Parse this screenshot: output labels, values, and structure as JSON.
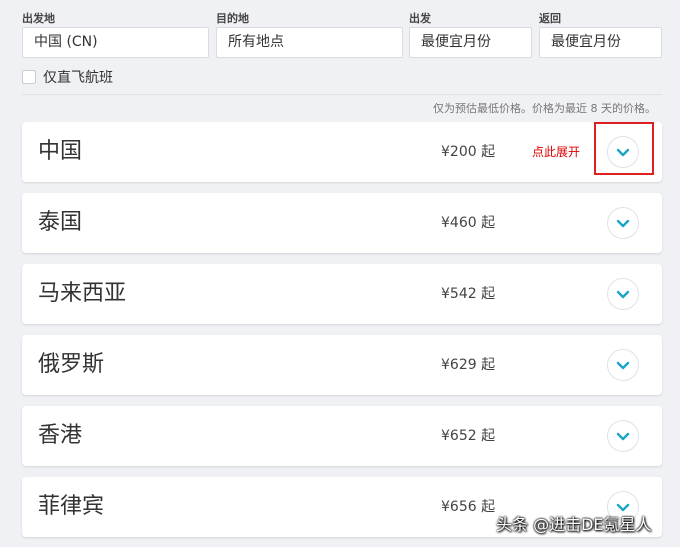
{
  "search": {
    "origin": {
      "label": "出发地",
      "value": "中国 (CN)"
    },
    "destination": {
      "label": "目的地",
      "value": "所有地点"
    },
    "depart": {
      "label": "出发",
      "value": "最便宜月份"
    },
    "return": {
      "label": "返回",
      "value": "最便宜月份"
    },
    "direct_only": {
      "label": "仅直飞航班",
      "checked": false
    }
  },
  "price_note": "仅为预估最低价格。价格为最近 8 天的价格。",
  "annotation": "点此展开",
  "results": [
    {
      "name": "中国",
      "price": "¥200 起"
    },
    {
      "name": "泰国",
      "price": "¥460 起"
    },
    {
      "name": "马来西亚",
      "price": "¥542 起"
    },
    {
      "name": "俄罗斯",
      "price": "¥629 起"
    },
    {
      "name": "香港",
      "price": "¥652 起"
    },
    {
      "name": "菲律宾",
      "price": "¥656 起"
    }
  ],
  "watermark": "头条 @进击DE氪星人",
  "colors": {
    "accent": "#1aa5c8",
    "annotation": "#e02020"
  }
}
